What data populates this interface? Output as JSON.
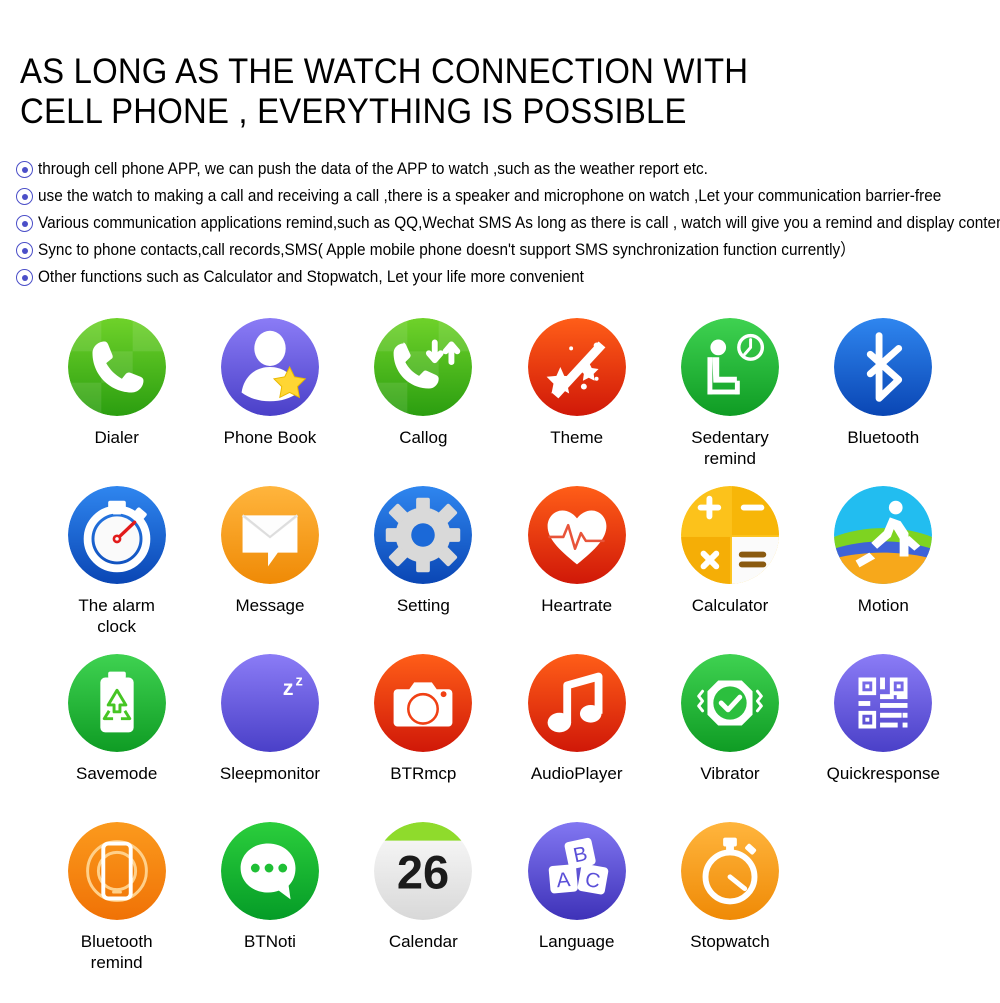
{
  "heading": {
    "line1": "AS LONG AS THE WATCH  CONNECTION WITH",
    "line2": "CELL PHONE , EVERYTHING IS POSSIBLE",
    "full": "AS LONG AS THE WATCH  CONNECTION WITH\nCELL PHONE , EVERYTHING IS POSSIBLE"
  },
  "bullet_marker": "circled-dot",
  "bullet_color": "#4b4fc8",
  "features": [
    "through cell phone APP, we can push the data of the APP to watch ,such as the weather report etc.",
    "use the watch to making a call and receiving a call ,there is a speaker and  microphone on watch ,Let your communication barrier-free",
    "Various communication applications remind,such as QQ,Wechat SMS As long as there is call , watch will give you a remind and display content",
    "Sync to phone contacts,call records,SMS( Apple mobile phone doesn't support SMS synchronization function currently）",
    "Other functions such as Calculator and Stopwatch, Let your life more convenient"
  ],
  "apps": [
    {
      "label": "Dialer",
      "icon": "dialer-icon",
      "color": "#4caf16"
    },
    {
      "label": "Phone Book",
      "icon": "phone-book-icon",
      "color": "#7a6df0"
    },
    {
      "label": "Callog",
      "icon": "callog-icon",
      "color": "#4caf16"
    },
    {
      "label": "Theme",
      "icon": "theme-icon",
      "color": "#f03d14"
    },
    {
      "label": "Sedentary\nremind",
      "icon": "sedentary-remind-icon",
      "color": "#23bf3c"
    },
    {
      "label": "Bluetooth",
      "icon": "bluetooth-icon",
      "color": "#1566d6"
    },
    {
      "label": "The alarm\nclock",
      "icon": "alarm-clock-icon",
      "color": "#1667e0"
    },
    {
      "label": "Message",
      "icon": "message-icon",
      "color": "#f0a020"
    },
    {
      "label": "Setting",
      "icon": "setting-icon",
      "color": "#1b69d8"
    },
    {
      "label": "Heartrate",
      "icon": "heartrate-icon",
      "color": "#ee4014"
    },
    {
      "label": "Calculator",
      "icon": "calculator-icon",
      "color": "#f9b018"
    },
    {
      "label": "Motion",
      "icon": "motion-icon",
      "color": "#22b9e8"
    },
    {
      "label": "Savemode",
      "icon": "savemode-icon",
      "color": "#27c23c"
    },
    {
      "label": "Sleepmonitor",
      "icon": "sleepmonitor-icon",
      "color": "#7a6df0"
    },
    {
      "label": "BTRmcp",
      "icon": "btrmcp-camera-icon",
      "color": "#f04014"
    },
    {
      "label": "AudioPlayer",
      "icon": "audioplayer-icon",
      "color": "#f03a14"
    },
    {
      "label": "Vibrator",
      "icon": "vibrator-icon",
      "color": "#27c23c"
    },
    {
      "label": "Quickresponse",
      "icon": "quickresponse-qr-icon",
      "color": "#7a6df0"
    },
    {
      "label": "Bluetooth\nremind",
      "icon": "bluetooth-remind-icon",
      "color": "#f58410"
    },
    {
      "label": "BTNoti",
      "icon": "btnoti-icon",
      "color": "#18b830"
    },
    {
      "label": "Calendar",
      "icon": "calendar-icon",
      "color": "#e6e6e6",
      "day": "26"
    },
    {
      "label": "Language",
      "icon": "language-icon",
      "color": "#6a5fe0"
    },
    {
      "label": "Stopwatch",
      "icon": "stopwatch-icon",
      "color": "#f9a81b"
    }
  ]
}
